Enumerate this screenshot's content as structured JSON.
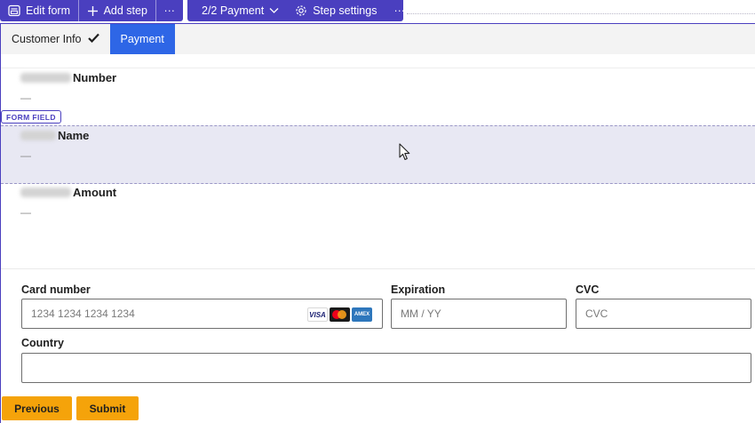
{
  "toolbar": {
    "edit_form": "Edit form",
    "add_step": "Add step",
    "more_1": "···",
    "step_dropdown": "2/2 Payment",
    "step_settings": "Step settings",
    "more_2": "···"
  },
  "tabs": [
    {
      "label": "Customer Info",
      "completed": true
    },
    {
      "label": "Payment",
      "active": true
    }
  ],
  "fields": [
    {
      "label": "Number",
      "value": "—"
    },
    {
      "label": "Name",
      "value": "—"
    },
    {
      "label": "Amount",
      "value": "—"
    }
  ],
  "selection_badge": "FORM FIELD",
  "payment": {
    "card_number_label": "Card number",
    "card_number_placeholder": "1234 1234 1234 1234",
    "card_brands": [
      "VISA",
      "Mastercard",
      "AMEX"
    ],
    "expiration_label": "Expiration",
    "expiration_placeholder": "MM / YY",
    "cvc_label": "CVC",
    "cvc_placeholder": "CVC",
    "country_label": "Country",
    "country_value": ""
  },
  "buttons": {
    "previous": "Previous",
    "submit": "Submit"
  },
  "colors": {
    "toolbar": "#4a3fbf",
    "active_tab": "#2e66e6",
    "selected_field": "#e8e8f3",
    "nav_button": "#f5a30a"
  }
}
